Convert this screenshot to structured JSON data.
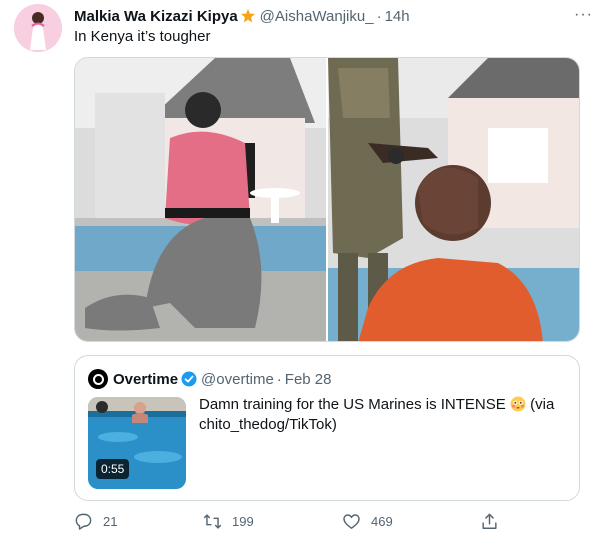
{
  "tweet": {
    "display_name": "Malkia Wa Kizazi Kipya",
    "badge_icon": "star-badge-icon",
    "handle": "@AishaWanjiku_",
    "separator": "·",
    "time": "14h",
    "text": "In Kenya it’s tougher",
    "more_icon": "more-horizontal-icon",
    "more_glyph": "···"
  },
  "quoted_tweet": {
    "display_name": "Overtime",
    "handle": "@overtime",
    "separator": "·",
    "date": "Feb 28",
    "text": "Damn training for the US Marines is INTENSE",
    "text_emoji": "flushed-face-emoji",
    "text_suffix": "(via chito_thedog/TikTok)",
    "video_duration": "0:55"
  },
  "actions": {
    "replies": "21",
    "retweets": "199",
    "likes": "469"
  },
  "colors": {
    "text_primary": "#0f1419",
    "text_secondary": "#536471",
    "verified_blue": "#1d9bf0",
    "border": "#cfd9de"
  }
}
